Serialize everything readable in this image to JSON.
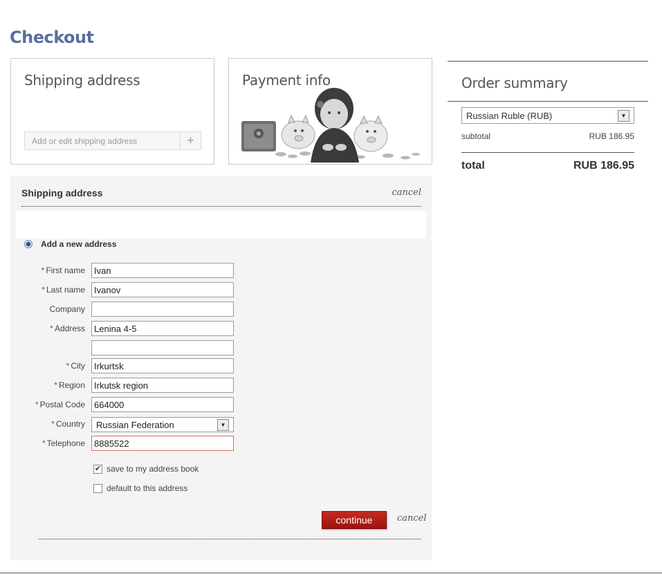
{
  "page": {
    "title": "Checkout"
  },
  "shipping_card": {
    "title": "Shipping address",
    "picker_placeholder": "Add or edit shipping address",
    "add_icon": "plus-icon"
  },
  "payment_card": {
    "title": "Payment info"
  },
  "order_summary": {
    "title": "Order summary",
    "currency": "Russian Ruble (RUB)",
    "subtotal_label": "subtotal",
    "subtotal_value": "RUB 186.95",
    "total_label": "total",
    "total_value": "RUB 186.95"
  },
  "form": {
    "title": "Shipping address",
    "cancel_label": "cancel",
    "new_address_label": "Add a new address",
    "fields": {
      "first_name": {
        "label": "First name",
        "value": "Ivan",
        "required": true
      },
      "last_name": {
        "label": "Last name",
        "value": "Ivanov",
        "required": true
      },
      "company": {
        "label": "Company",
        "value": "",
        "required": false
      },
      "address": {
        "label": "Address",
        "value": "Lenina 4-5",
        "required": true
      },
      "address2": {
        "label": "",
        "value": ""
      },
      "city": {
        "label": "City",
        "value": "Irkurtsk",
        "required": true
      },
      "region": {
        "label": "Region",
        "value": "Irkutsk region",
        "required": true
      },
      "postal_code": {
        "label": "Postal Code",
        "value": "664000",
        "required": true
      },
      "country": {
        "label": "Country",
        "value": "Russian Federation",
        "required": true
      },
      "telephone": {
        "label": "Telephone",
        "value": "8885522",
        "required": true
      }
    },
    "save_to_book": {
      "label": "save to my address book",
      "checked": true
    },
    "default_address": {
      "label": "default to this address",
      "checked": false
    },
    "continue_label": "continue",
    "required_mark": "*"
  },
  "colors": {
    "title_blue": "#5a6e9e",
    "button_red": "#b01e18",
    "panel_bg": "#f4f4f4",
    "error_border": "#e07050"
  }
}
